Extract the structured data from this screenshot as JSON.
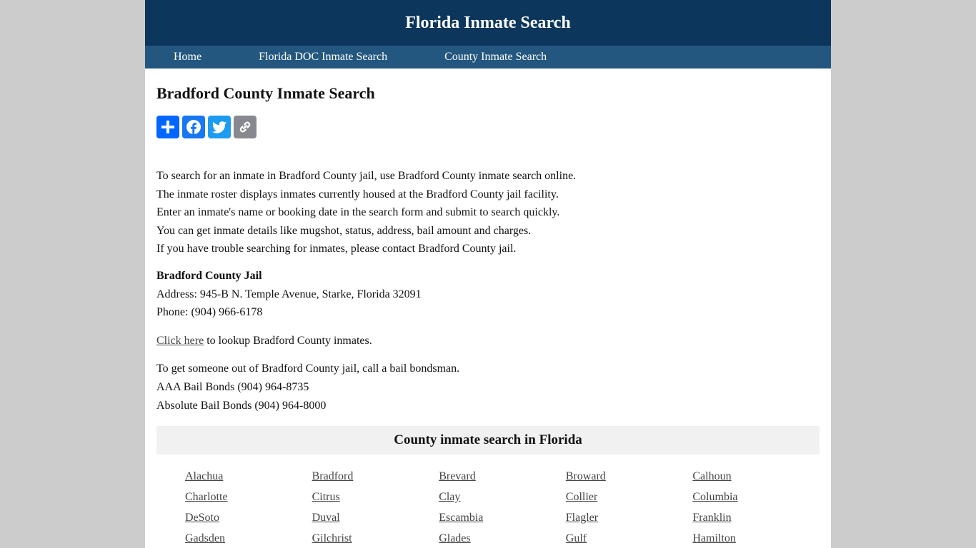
{
  "header": {
    "site_title": "Florida Inmate Search"
  },
  "nav": {
    "items": [
      {
        "label": "Home"
      },
      {
        "label": "Florida DOC Inmate Search"
      },
      {
        "label": "County Inmate Search"
      }
    ]
  },
  "main": {
    "title": "Bradford County Inmate Search",
    "share": [
      {
        "name": "Share",
        "icon": "plus-icon",
        "color": "#0166ff"
      },
      {
        "name": "Facebook",
        "icon": "facebook-icon",
        "color": "#1877f2"
      },
      {
        "name": "Twitter",
        "icon": "twitter-icon",
        "color": "#1d9bf0"
      },
      {
        "name": "Copy Link",
        "icon": "link-icon",
        "color": "#888990"
      }
    ],
    "intro": [
      "To search for an inmate in Bradford County jail, use Bradford County inmate search online.",
      "The inmate roster displays inmates currently housed at the Bradford County jail facility.",
      "Enter an inmate's name or booking date in the search form and submit to search quickly.",
      "You can get inmate details like mugshot, status, address, bail amount and charges.",
      "If you have trouble searching for inmates, please contact Bradford County jail."
    ],
    "jail": {
      "name": "Bradford County Jail",
      "address": "Address: 945-B N. Temple Avenue, Starke, Florida 32091",
      "phone": "Phone: (904) 966-6178"
    },
    "lookup": {
      "link_label": "Click here",
      "suffix": " to lookup Bradford County inmates."
    },
    "bail": [
      "To get someone out of Bradford County jail, call a bail bondsman.",
      "AAA Bail Bonds (904) 964-8735",
      "Absolute Bail Bonds (904) 964-8000"
    ]
  },
  "counties": {
    "heading": "County inmate search in Florida",
    "items": [
      "Alachua",
      "Bradford",
      "Brevard",
      "Broward",
      "Calhoun",
      "Charlotte",
      "Citrus",
      "Clay",
      "Collier",
      "Columbia",
      "DeSoto",
      "Duval",
      "Escambia",
      "Flagler",
      "Franklin",
      "Gadsden",
      "Gilchrist",
      "Glades",
      "Gulf",
      "Hamilton"
    ]
  }
}
